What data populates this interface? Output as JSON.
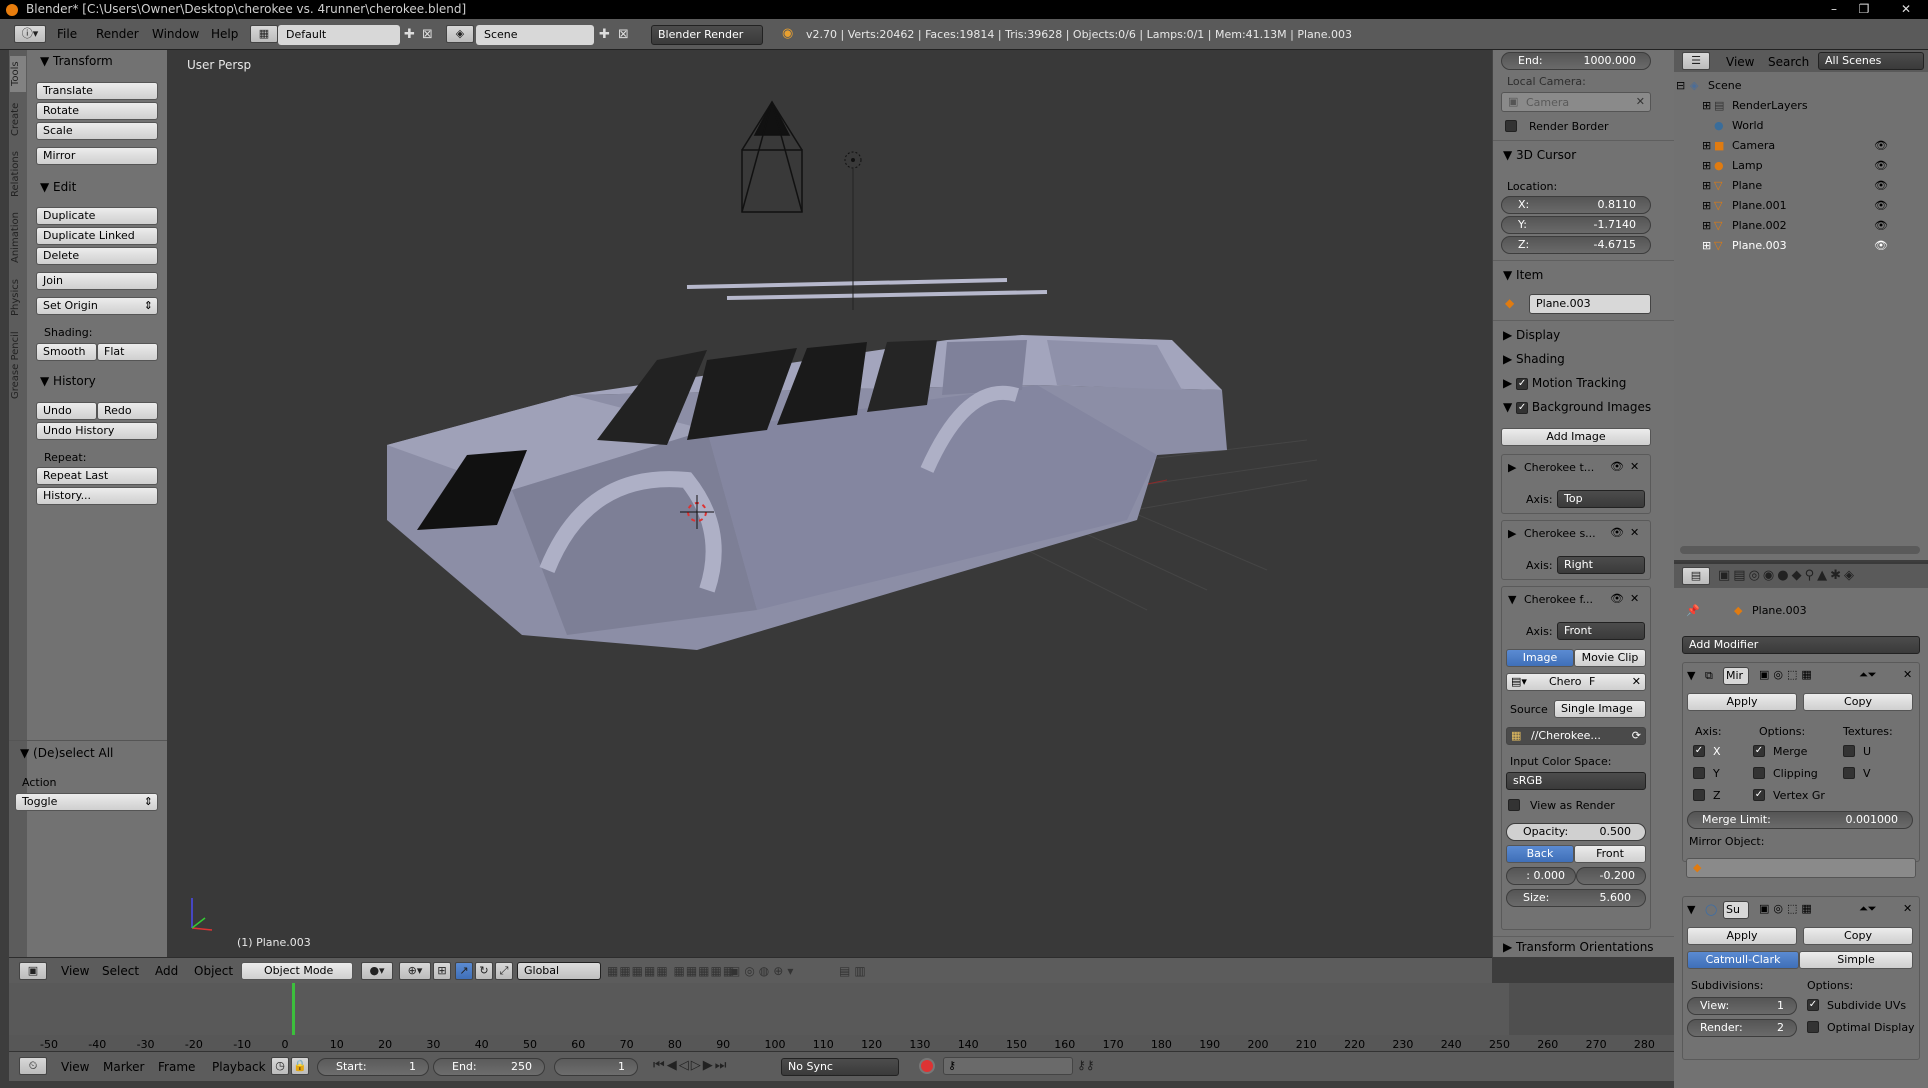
{
  "window": {
    "title": "Blender* [C:\\Users\\Owner\\Desktop\\cherokee vs. 4runner\\cherokee.blend]",
    "controls": [
      "–",
      "❐",
      "✕"
    ]
  },
  "info_header": {
    "menus": [
      "File",
      "Render",
      "Window",
      "Help"
    ],
    "layout": "Default",
    "scene": "Scene",
    "engine": "Blender Render",
    "stats": "v2.70 | Verts:20462 | Faces:19814 | Tris:39628 | Objects:0/6 | Lamps:0/1 | Mem:41.13M | Plane.003"
  },
  "tool_shelf": {
    "tabs": [
      "Tools",
      "Create",
      "Relations",
      "Animation",
      "Physics",
      "Grease Pencil"
    ],
    "transform": {
      "title": "Transform",
      "buttons": [
        "Translate",
        "Rotate",
        "Scale",
        "Mirror"
      ]
    },
    "edit": {
      "title": "Edit",
      "buttons": [
        "Duplicate",
        "Duplicate Linked",
        "Delete",
        "Join"
      ],
      "set_origin": "Set Origin",
      "shading_label": "Shading:",
      "smooth": "Smooth",
      "flat": "Flat"
    },
    "history": {
      "title": "History",
      "undo": "Undo",
      "redo": "Redo",
      "undo_history": "Undo History",
      "repeat_label": "Repeat:",
      "repeat_last": "Repeat Last",
      "history_btn": "History..."
    },
    "operator": {
      "title": "(De)select All",
      "action_label": "Action",
      "action_value": "Toggle"
    }
  },
  "viewport": {
    "view_label": "User Persp",
    "object_label": "(1) Plane.003"
  },
  "n_panel": {
    "end": {
      "label": "End:",
      "value": "1000.000"
    },
    "local_camera_label": "Local Camera:",
    "camera_placeholder": "Camera",
    "render_border": "Render Border",
    "cursor": {
      "title": "3D Cursor",
      "location_label": "Location:",
      "x": {
        "label": "X:",
        "value": "0.8110"
      },
      "y": {
        "label": "Y:",
        "value": "-1.7140"
      },
      "z": {
        "label": "Z:",
        "value": "-4.6715"
      }
    },
    "item": {
      "title": "Item",
      "name": "Plane.003"
    },
    "display": "Display",
    "shading": "Shading",
    "motion_tracking": "Motion Tracking",
    "background_images": "Background Images",
    "add_image": "Add Image",
    "bg_images": [
      {
        "name": "Cherokee t...",
        "axis_label": "Axis:",
        "axis": "Top"
      },
      {
        "name": "Cherokee s...",
        "axis_label": "Axis:",
        "axis": "Right"
      },
      {
        "name": "Cherokee f...",
        "axis_label": "Axis:",
        "axis": "Front"
      }
    ],
    "image_tab": "Image",
    "movie_clip_tab": "Movie Clip",
    "image_name": "Chero",
    "image_f": "F",
    "source_label": "Source",
    "source_value": "Single Image",
    "filepath": "//Cherokee...",
    "color_space_label": "Input Color Space:",
    "color_space": "sRGB",
    "view_as_render": "View as Render",
    "opacity": {
      "label": "Opacity:",
      "value": "0.500"
    },
    "back": "Back",
    "front": "Front",
    "offset_x": ": 0.000",
    "offset_y": "-0.200",
    "size": {
      "label": "Size:",
      "value": "5.600"
    },
    "transform_orientations": "Transform Orientations"
  },
  "outliner": {
    "menus": [
      "View",
      "Search"
    ],
    "filter": "All Scenes",
    "items": [
      {
        "name": "Scene"
      },
      {
        "name": "RenderLayers"
      },
      {
        "name": "World"
      },
      {
        "name": "Camera"
      },
      {
        "name": "Lamp"
      },
      {
        "name": "Plane"
      },
      {
        "name": "Plane.001"
      },
      {
        "name": "Plane.002"
      },
      {
        "name": "Plane.003"
      }
    ]
  },
  "properties": {
    "object_name": "Plane.003",
    "add_modifier": "Add Modifier",
    "mirror": {
      "name": "Mir",
      "apply": "Apply",
      "copy": "Copy",
      "axis_label": "Axis:",
      "options_label": "Options:",
      "textures_label": "Textures:",
      "x": "X",
      "y": "Y",
      "z": "Z",
      "merge": "Merge",
      "clipping": "Clipping",
      "vertex_gr": "Vertex Gr",
      "u": "U",
      "v": "V",
      "merge_limit": {
        "label": "Merge Limit:",
        "value": "0.001000"
      },
      "mirror_object_label": "Mirror Object:"
    },
    "subsurf": {
      "name": "Su",
      "apply": "Apply",
      "copy": "Copy",
      "catmull": "Catmull-Clark",
      "simple": "Simple",
      "subdivisions_label": "Subdivisions:",
      "options_label": "Options:",
      "view": {
        "label": "View:",
        "value": "1"
      },
      "render": {
        "label": "Render:",
        "value": "2"
      },
      "subdivide_uvs": "Subdivide UVs",
      "optimal_display": "Optimal Display"
    }
  },
  "viewport_header": {
    "menus": [
      "View",
      "Select",
      "Add",
      "Object"
    ],
    "mode": "Object Mode",
    "orientation": "Global"
  },
  "timeline": {
    "ticks": [
      "-50",
      "-40",
      "-30",
      "-20",
      "-10",
      "0",
      "10",
      "20",
      "30",
      "40",
      "50",
      "60",
      "70",
      "80",
      "90",
      "100",
      "110",
      "120",
      "130",
      "140",
      "150",
      "160",
      "170",
      "180",
      "190",
      "200",
      "210",
      "220",
      "230",
      "240",
      "250",
      "260",
      "270",
      "280"
    ],
    "menus": [
      "View",
      "Marker",
      "Frame",
      "Playback"
    ],
    "start": {
      "label": "Start:",
      "value": "1"
    },
    "end": {
      "label": "End:",
      "value": "250"
    },
    "current": "1",
    "sync": "No Sync"
  }
}
